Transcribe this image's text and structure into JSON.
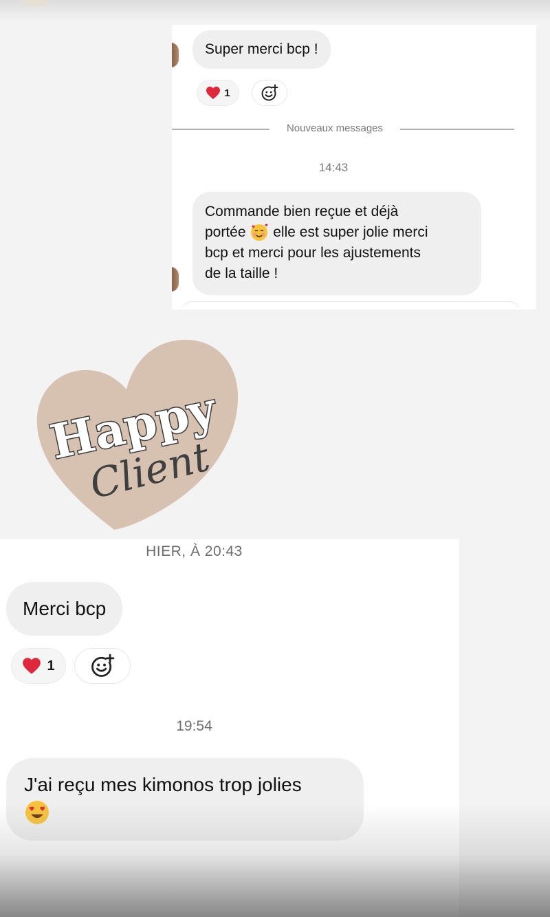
{
  "top": {
    "sent_message": "Super merci bcp !",
    "reaction_emoji": "red-heart",
    "reaction_count": "1",
    "divider_label": "Nouveaux messages",
    "timestamp": "14:43",
    "message_lines": [
      "Commande bien reçue et déjà",
      "portée",
      "elle est super jolie merci",
      "bcp et merci pour les ajustements",
      "de la taille !"
    ],
    "message_emoji": "smiling-face-with-hearts"
  },
  "sticker": {
    "line1": "Happy",
    "line2": "Client"
  },
  "bottom": {
    "timestamp_yesterday": "HIER, À 20:43",
    "message1": "Merci bcp",
    "reaction_emoji": "red-heart",
    "reaction_count": "1",
    "timestamp": "19:54",
    "message2": "J'ai reçu mes kimonos trop jolies",
    "message2_emoji": "heart-eyes"
  },
  "colors": {
    "bubble": "#efefef",
    "heart_fill": "#d7c2b2",
    "divider": "#b0b0b0",
    "heart_emoji": "#e0283c"
  }
}
